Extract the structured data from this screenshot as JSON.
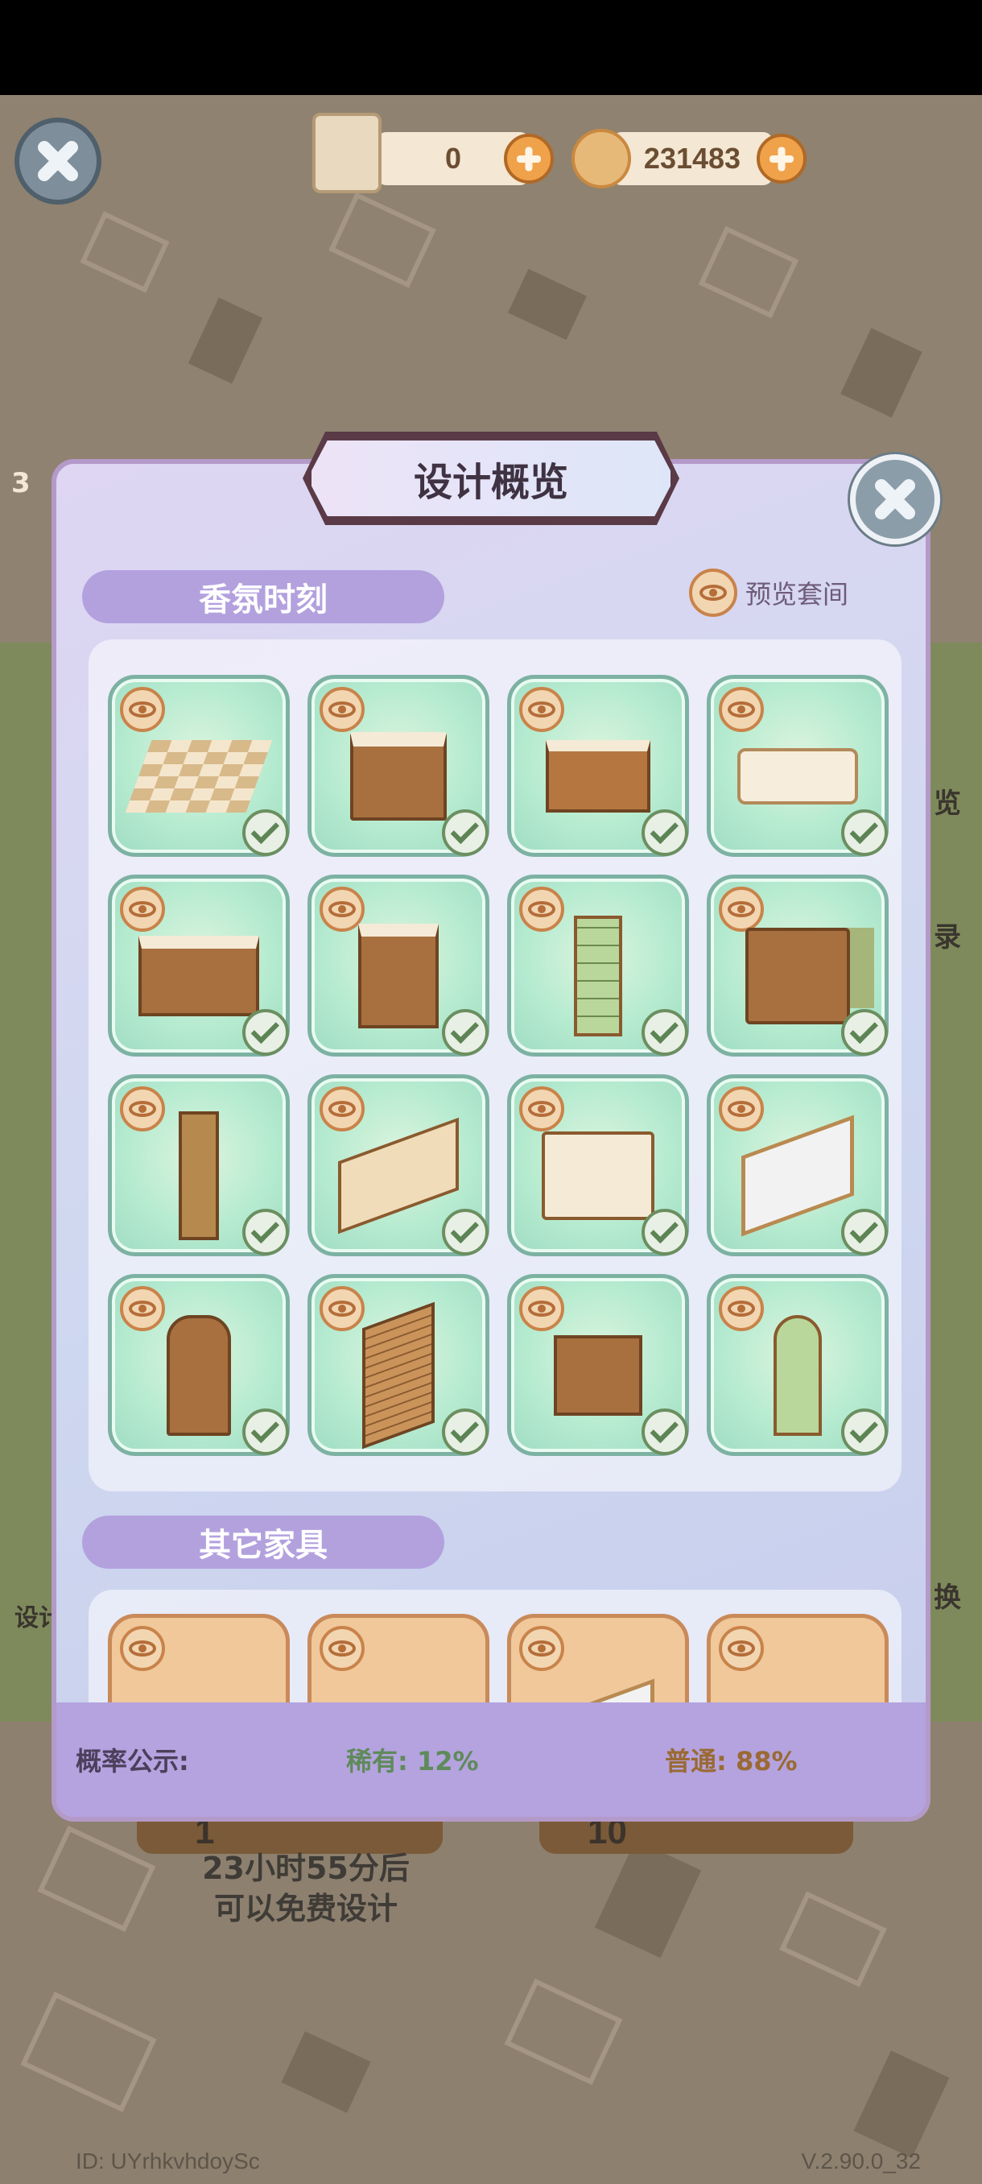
{
  "header": {
    "scroll_count": "0",
    "coin_count": "231483"
  },
  "background": {
    "free_design_line1": "23小时55分后",
    "free_design_line2": "可以免费设计",
    "ticket_single": "1",
    "ticket_ten": "10",
    "left_badge": "3",
    "side_right_1": "览",
    "side_right_2": "录",
    "side_right_3": "换",
    "side_left_1": "设计"
  },
  "dialog": {
    "title": "设计概览",
    "section1_title": "香氛时刻",
    "preview_room_label": "预览套间",
    "section2_title": "其它家具",
    "probability_label": "概率公示:",
    "rare_label": "稀有: 12%",
    "normal_label": "普通: 88%",
    "items": [
      {
        "icon": "floor-tiles-icon",
        "owned": true
      },
      {
        "icon": "cabinet-icon",
        "owned": true
      },
      {
        "icon": "bathroom-sink-icon",
        "owned": true
      },
      {
        "icon": "bathtub-icon",
        "owned": true
      },
      {
        "icon": "sideboard-icon",
        "owned": true
      },
      {
        "icon": "shelf-cabinet-icon",
        "owned": true
      },
      {
        "icon": "window-panel-icon",
        "owned": true
      },
      {
        "icon": "toilet-icon",
        "owned": true
      },
      {
        "icon": "tall-cabinet-icon",
        "owned": true
      },
      {
        "icon": "wall-panel-icon",
        "owned": true
      },
      {
        "icon": "washing-machine-icon",
        "owned": true
      },
      {
        "icon": "mirror-icon",
        "owned": true
      },
      {
        "icon": "display-cabinet-icon",
        "owned": true
      },
      {
        "icon": "blinds-icon",
        "owned": true
      },
      {
        "icon": "storage-shelf-icon",
        "owned": true
      },
      {
        "icon": "arched-window-icon",
        "owned": true
      }
    ],
    "other_items": [
      {
        "icon": "rug-icon"
      },
      {
        "icon": "table-icon"
      },
      {
        "icon": "mirror-icon"
      },
      {
        "icon": "cushion-icon"
      }
    ]
  },
  "footer": {
    "user_id": "ID: UYrhkvhdoySc",
    "version": "V.2.90.0_32"
  },
  "colors": {
    "panel_tab": "#b3a1de",
    "rare": "#5f8a5a",
    "normal": "#9a6a33",
    "item_bg": "#b6ebd0"
  }
}
